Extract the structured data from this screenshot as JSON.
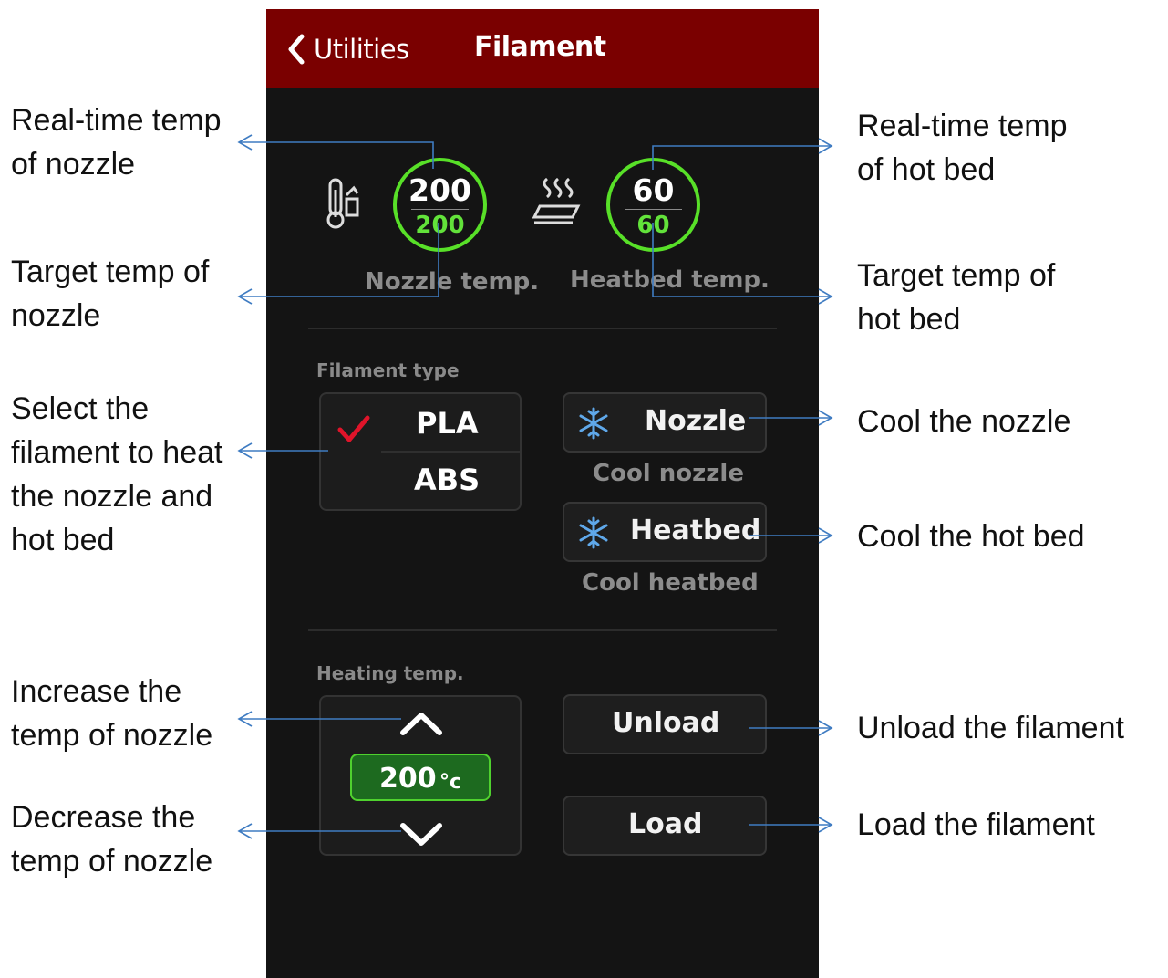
{
  "header": {
    "back_label": "Utilities",
    "title": "Filament"
  },
  "nozzle": {
    "current": "200",
    "target": "200",
    "caption": "Nozzle temp."
  },
  "heatbed": {
    "current": "60",
    "target": "60",
    "caption": "Heatbed temp."
  },
  "filament_section": {
    "label": "Filament type",
    "options": [
      "PLA",
      "ABS"
    ],
    "selected": "PLA"
  },
  "cool": {
    "nozzle_button": "Nozzle",
    "nozzle_caption": "Cool nozzle",
    "heatbed_button": "Heatbed",
    "heatbed_caption": "Cool heatbed"
  },
  "heating_section": {
    "label": "Heating temp.",
    "value": "200",
    "unit": "°c"
  },
  "actions": {
    "unload": "Unload",
    "load": "Load"
  },
  "annotations": {
    "realtime_nozzle": "Real-time temp\nof nozzle",
    "target_nozzle": "Target temp of\nnozzle",
    "select_filament": "Select the\nfilament to heat\nthe nozzle and\nhot bed",
    "increase": "Increase the\ntemp of nozzle",
    "decrease": "Decrease the\ntemp of nozzle",
    "realtime_bed": "Real-time temp\nof hot bed",
    "target_bed": "Target temp of\nhot bed",
    "cool_nozzle": "Cool the nozzle",
    "cool_bed": "Cool the hot bed",
    "unload": "Unload the filament",
    "load": "Load the filament"
  },
  "colors": {
    "header": "#7a0000",
    "screen": "#141414",
    "ring": "#58e028",
    "check": "#e0142a",
    "snowflake": "#5fa8ea",
    "arrow": "#3f7cc2"
  }
}
